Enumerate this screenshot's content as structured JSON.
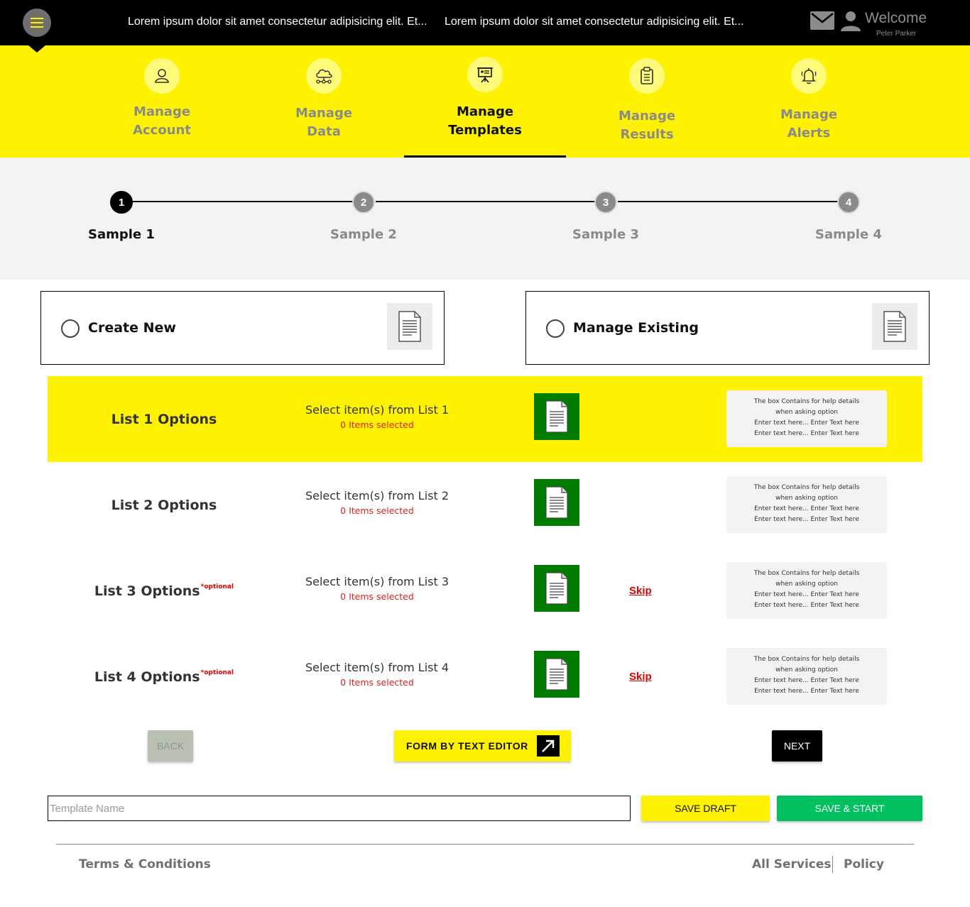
{
  "header": {
    "marquee": [
      "Lorem ipsum dolor sit amet consectetur adipisicing elit. Et...",
      "Lorem ipsum dolor sit amet consectetur adipisicing elit. Et..."
    ],
    "welcome": "Welcome",
    "username": "Peter Parker"
  },
  "nav": {
    "items": [
      {
        "line1": "Manage",
        "line2": "Account",
        "icon": "user-icon"
      },
      {
        "line1": "Manage",
        "line2": "Data",
        "icon": "cloud-network-icon"
      },
      {
        "line1": "Manage",
        "line2": "Templates",
        "icon": "presentation-icon",
        "active": true
      },
      {
        "line1": "Manage",
        "line2": "Results",
        "icon": "clipboard-icon"
      },
      {
        "line1": "Manage",
        "line2": "Alerts",
        "icon": "bell-icon"
      }
    ]
  },
  "stepper": {
    "steps": [
      {
        "number": "1",
        "label": "Sample 1",
        "active": true
      },
      {
        "number": "2",
        "label": "Sample 2"
      },
      {
        "number": "3",
        "label": "Sample 3"
      },
      {
        "number": "4",
        "label": "Sample 4"
      }
    ]
  },
  "choices": {
    "create_new": "Create New",
    "manage_existing": "Manage Existing"
  },
  "lists": [
    {
      "title": "List 1 Options",
      "optional": "",
      "select": "Select item(s) from List 1",
      "count": "0 Items selected",
      "skip": "",
      "highlight": true
    },
    {
      "title": "List 2 Options",
      "optional": "",
      "select": "Select item(s) from List 2",
      "count": "0 Items selected",
      "skip": ""
    },
    {
      "title": "List 3 Options",
      "optional": "*optional",
      "select": "Select item(s) from List 3",
      "count": "0 Items selected",
      "skip": "Skip"
    },
    {
      "title": "List 4 Options",
      "optional": "*optional",
      "select": "Select item(s) from List 4",
      "count": "0 Items selected",
      "skip": "Skip"
    }
  ],
  "help_box": {
    "line1": "The box Contains for help details",
    "line2": "when asking option",
    "line3": "Enter text here... Enter Text here",
    "line4": "Enter text here... Enter Text here"
  },
  "actions": {
    "back": "BACK",
    "editor": "FORM BY TEXT EDITOR",
    "next": "NEXT"
  },
  "template": {
    "placeholder": "Template Name",
    "value": "",
    "save_draft": "SAVE DRAFT",
    "save_start": "SAVE & START"
  },
  "footer": {
    "terms": "Terms & Conditions",
    "services": "All Services",
    "policy": "Policy"
  },
  "colors": {
    "brand_yellow": "#fff200",
    "header_black": "#000000",
    "doc_green": "#007d00",
    "start_green": "#00c060",
    "alert_red": "#e02020"
  }
}
